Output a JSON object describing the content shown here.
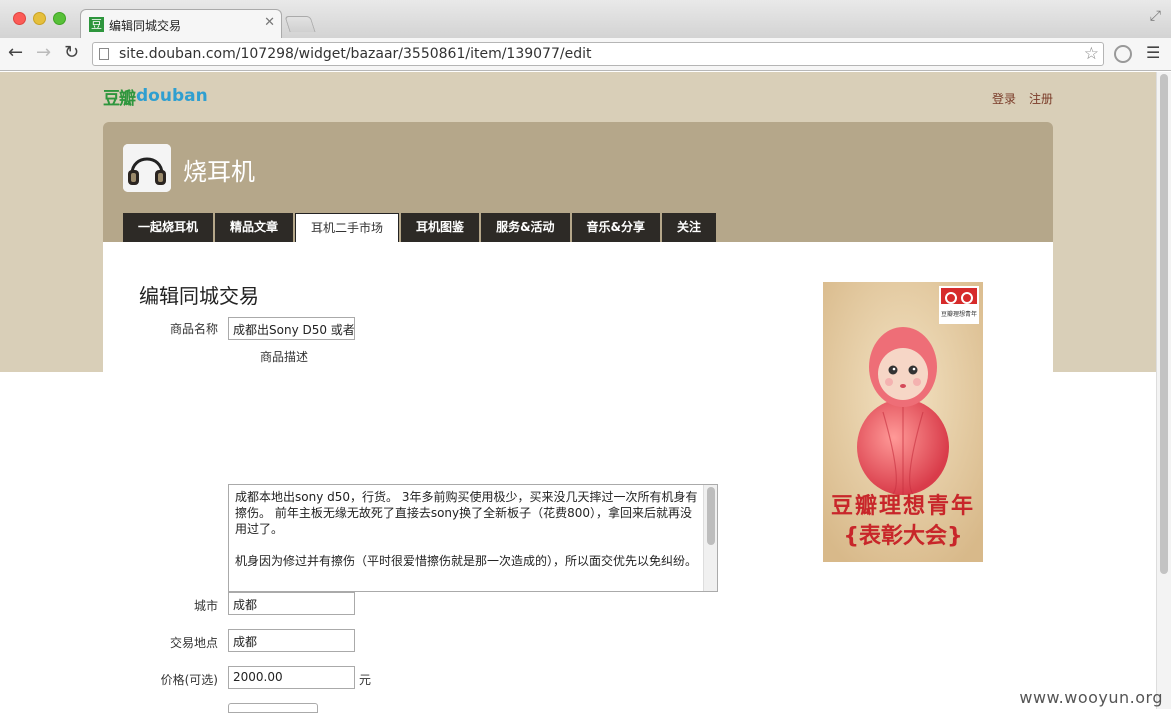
{
  "browser": {
    "tab_title": "编辑同城交易",
    "tab_favicon": "豆",
    "url": "site.douban.com/107298/widget/bazaar/3550861/item/139077/edit"
  },
  "site": {
    "logo_cn": "豆瓣",
    "logo_en": "douban",
    "login": "登录",
    "register": "注册",
    "title": "烧耳机",
    "nav": [
      "一起烧耳机",
      "精品文章",
      "耳机二手市场",
      "耳机图鉴",
      "服务&活动",
      "音乐&分享",
      "关注"
    ],
    "active_nav": "耳机二手市场"
  },
  "form": {
    "page_title": "编辑同城交易",
    "name_label": "商品名称",
    "name_value": "成都出Sony D50 或者",
    "desc_label": "商品描述",
    "desc_paragraphs": [
      "成都本地出sony d50，行货。 3年多前购买使用极少，买来没几天摔过一次所有机身有擦伤。 前年主板无缘无故死了直接去sony换了全新板子（花费800），拿回来后就再没用过了。",
      "机身因为修过并有擦伤（平时很爱惜擦伤就是那一次造成的），所以面交优先以免纠纷。"
    ],
    "city_label": "城市",
    "city_value": "成都",
    "place_label": "交易地点",
    "place_value": "成都",
    "price_label": "价格(可选)",
    "price_value": "2000.00",
    "price_unit": "元"
  },
  "ad": {
    "badge_text": "豆瓣理想青年",
    "title_line1": "豆瓣理想青年",
    "title_line2": "{表彰大会}"
  },
  "watermark": "www.wooyun.org",
  "colors": {
    "page_bg": "#d9cfb8",
    "header_bg": "#b5a78a",
    "nav_bg": "#2d2a26",
    "link": "#7a3b28",
    "ad_red": "#c8262a"
  }
}
